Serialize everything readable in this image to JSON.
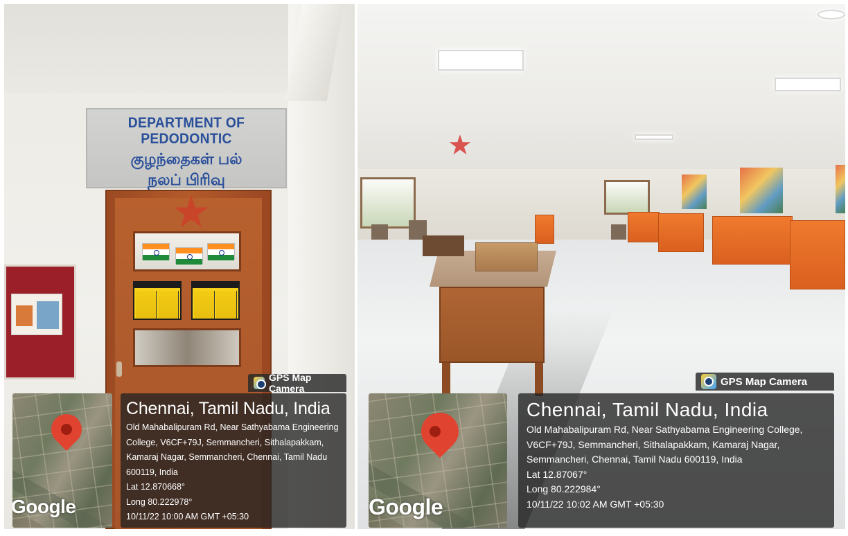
{
  "left_photo": {
    "sign": {
      "line1": "DEPARTMENT OF PEDODONTIC",
      "line2": "குழந்தைகள் பல்",
      "line3": "நலப் பிரிவு"
    },
    "gps": {
      "app_label": "GPS Map Camera",
      "city": "Chennai, Tamil Nadu, India",
      "address": "Old Mahabalipuram Rd, Near Sathyabama Engineering College, V6CF+79J, Semmancheri, Sithalapakkam, Kamaraj Nagar, Semmancheri, Chennai, Tamil Nadu 600119, India",
      "lat": "Lat 12.870668°",
      "long": "Long 80.222978°",
      "timestamp": "10/11/22 10:00 AM GMT +05:30",
      "map_brand": "Google"
    }
  },
  "right_photo": {
    "gps": {
      "app_label": "GPS Map Camera",
      "city": "Chennai, Tamil Nadu, India",
      "address": "Old Mahabalipuram Rd, Near Sathyabama Engineering College, V6CF+79J, Semmancheri, Sithalapakkam, Kamaraj Nagar, Semmancheri, Chennai, Tamil Nadu 600119, India",
      "lat": "Lat 12.87067°",
      "long": "Long 80.222984°",
      "timestamp": "10/11/22 10:02 AM GMT +05:30",
      "map_brand": "Google"
    }
  },
  "colors": {
    "sign_text": "#2a4f9a",
    "door_wood": "#b35a2b",
    "desk_orange": "#f07a2e",
    "map_pin": "#e0432f",
    "overlay_bg": "#232323"
  }
}
